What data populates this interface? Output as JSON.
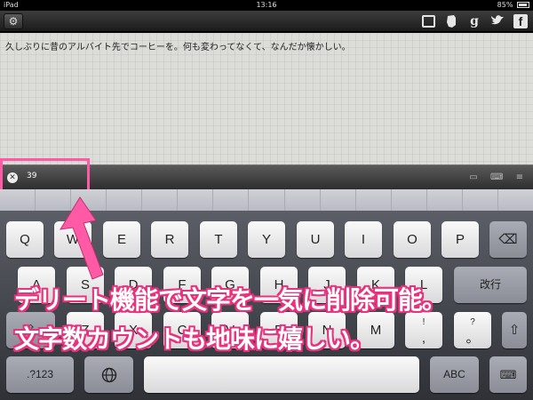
{
  "status_bar": {
    "device": "iPad",
    "time": "13:16",
    "battery": "85%"
  },
  "toolbar": {
    "settings_icon": "gear-icon",
    "icons": [
      "window-icon",
      "evernote-icon",
      "google-plus-icon",
      "twitter-icon",
      "facebook-icon"
    ],
    "google_plus_glyph": "g",
    "facebook_glyph": "f"
  },
  "editor": {
    "text": "久しぶりに昔のアルバイト先でコーヒーを。何も変わってなくて、なんだか懐かしい。"
  },
  "accessory_bar": {
    "char_count": "39",
    "clear_icon": "clear-x-icon",
    "icons": [
      "photo-icon",
      "keyboard-icon",
      "menu-icon"
    ]
  },
  "keyboard": {
    "row1": [
      "Q",
      "W",
      "E",
      "R",
      "T",
      "Y",
      "U",
      "I",
      "O",
      "P"
    ],
    "row2": [
      "A",
      "S",
      "D",
      "F",
      "G",
      "H",
      "J",
      "K",
      "L"
    ],
    "row2_return": "改行",
    "row3": [
      "Z",
      "X",
      "C",
      "V",
      "B",
      "N",
      "M"
    ],
    "row3_extra": [
      "!",
      "?"
    ],
    "row3_extra_sub": [
      ",",
      "。"
    ],
    "row4": {
      "numbers": ".?123",
      "abc": "ABC"
    }
  },
  "annotation": {
    "line1": "デリート機能で文字を一気に削除可能。",
    "line2": "文字数カウントも地味に嬉しい。"
  },
  "colors": {
    "highlight": "#ff5aa5",
    "annotation_outline": "#e8327d"
  }
}
